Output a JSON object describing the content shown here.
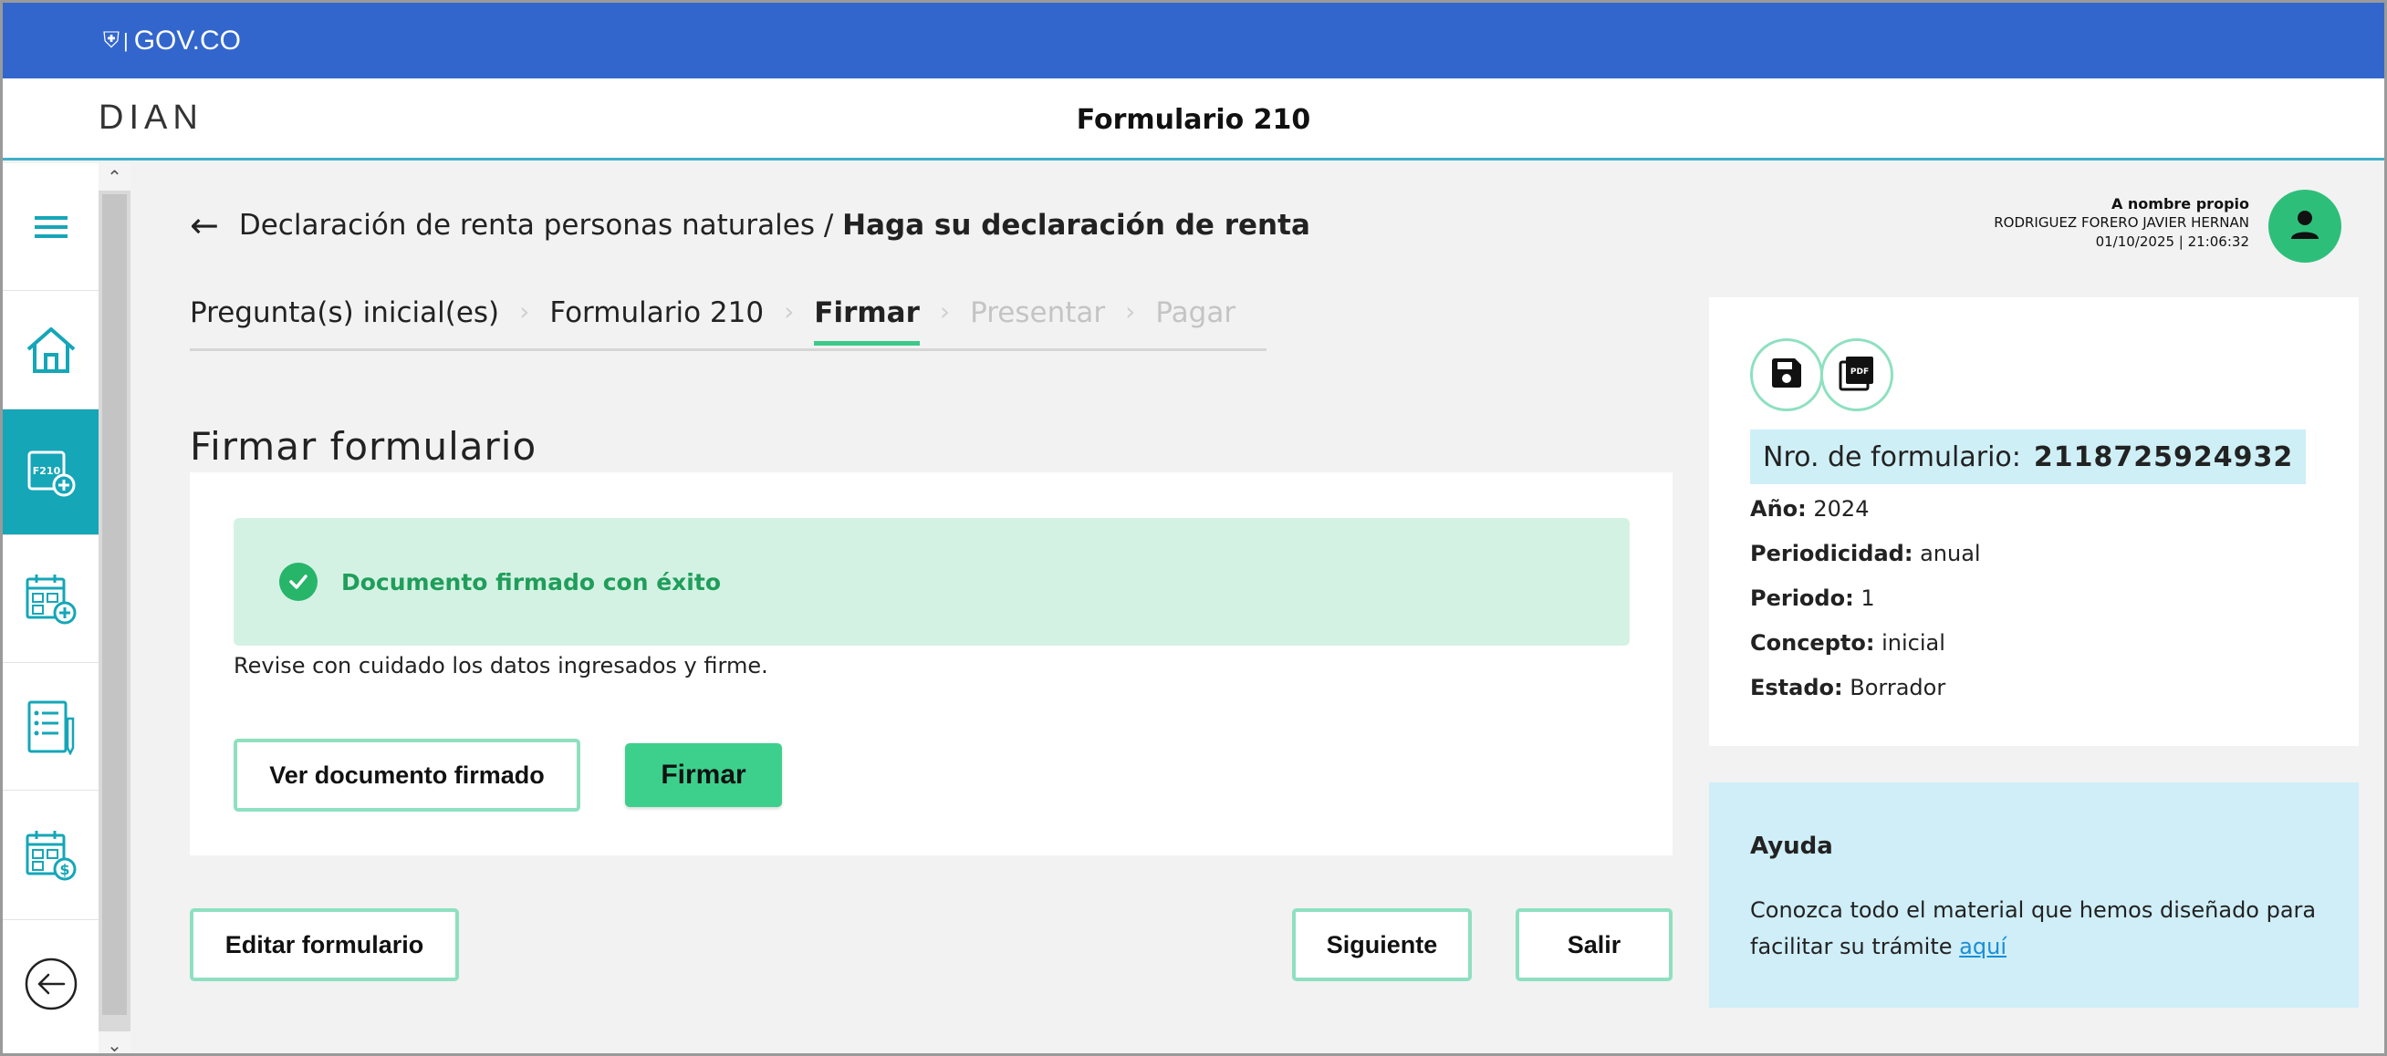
{
  "gov_bar": {
    "logo_text": "GOV.CO"
  },
  "header": {
    "logo": "DIAN",
    "title": "Formulario 210"
  },
  "sidebar": {
    "items": [
      {
        "icon": "menu-icon",
        "active": false
      },
      {
        "icon": "home-icon",
        "active": false
      },
      {
        "icon": "form-210-add-icon",
        "active": true,
        "label": "F210"
      },
      {
        "icon": "calendar-add-icon",
        "active": false
      },
      {
        "icon": "checklist-icon",
        "active": false
      },
      {
        "icon": "calendar-payment-icon",
        "active": false
      },
      {
        "icon": "back-circle-icon",
        "active": false
      }
    ]
  },
  "breadcrumb": {
    "parent": "Declaración de renta personas naturales /",
    "current": "Haga su declaración de renta"
  },
  "stepper": {
    "steps": [
      "Pregunta(s) inicial(es)",
      "Formulario 210",
      "Firmar",
      "Presentar",
      "Pagar"
    ],
    "active_index": 2
  },
  "main": {
    "section_title": "Firmar formulario",
    "alert_message": "Documento firmado con éxito",
    "instructions": "Revise con cuidado los datos ingresados y firme.",
    "view_signed_button": "Ver documento firmado",
    "sign_button": "Firmar",
    "edit_button": "Editar formulario",
    "next_button": "Siguiente",
    "exit_button": "Salir"
  },
  "user": {
    "mode": "A nombre propio",
    "name": "RODRIGUEZ FORERO JAVIER HERNAN",
    "datetime": "01/10/2025 | 21:06:32"
  },
  "form_info": {
    "number_label": "Nro. de formulario:",
    "number": "2118725924932",
    "pdf_label": "PDF",
    "fields": [
      {
        "label": "Año:",
        "value": "2024"
      },
      {
        "label": "Periodicidad:",
        "value": "anual"
      },
      {
        "label": "Periodo:",
        "value": "1"
      },
      {
        "label": "Concepto:",
        "value": "inicial"
      },
      {
        "label": "Estado:",
        "value": "Borrador"
      }
    ]
  },
  "help": {
    "title": "Ayuda",
    "body": "Conozca todo el material que hemos diseñado para facilitar su trámite",
    "link": "aquí"
  },
  "colors": {
    "gov_blue": "#3366cc",
    "accent_green": "#3dd08c",
    "active_teal": "#15a6b8",
    "success_bg": "#d4f2e4",
    "help_bg": "#cfeef7"
  }
}
